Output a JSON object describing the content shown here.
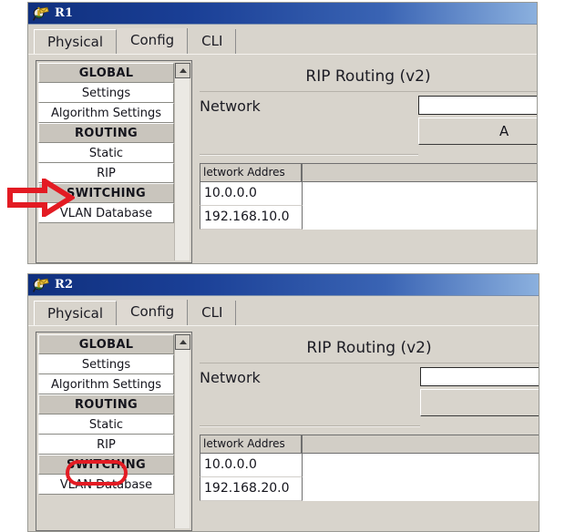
{
  "windows": [
    {
      "title": "R1",
      "icon": "packet-tracer-device-icon",
      "tabs": [
        {
          "label": "Physical",
          "selected": false
        },
        {
          "label": "Config",
          "selected": true
        },
        {
          "label": "CLI",
          "selected": false
        }
      ],
      "sidebar": {
        "items": [
          {
            "label": "GLOBAL",
            "type": "header"
          },
          {
            "label": "Settings",
            "type": "leaf"
          },
          {
            "label": "Algorithm Settings",
            "type": "leaf"
          },
          {
            "label": "ROUTING",
            "type": "header"
          },
          {
            "label": "Static",
            "type": "leaf"
          },
          {
            "label": "RIP",
            "type": "leaf"
          },
          {
            "label": "SWITCHING",
            "type": "header"
          },
          {
            "label": "VLAN Database",
            "type": "leaf"
          }
        ],
        "scroll_up_icon": "triangle-up-icon"
      },
      "panel": {
        "title": "RIP Routing (v2)",
        "network_label": "Network",
        "network_input_value": "",
        "network_input_placeholder": "",
        "add_button_label": "A",
        "table": {
          "columns": [
            "letwork Addres"
          ],
          "rows": [
            [
              "10.0.0.0"
            ],
            [
              "192.168.10.0"
            ]
          ]
        }
      },
      "annotation": {
        "kind": "red-arrow-right",
        "color": "#e31b23",
        "target": "RIP"
      }
    },
    {
      "title": "R2",
      "icon": "packet-tracer-device-icon",
      "tabs": [
        {
          "label": "Physical",
          "selected": false
        },
        {
          "label": "Config",
          "selected": true
        },
        {
          "label": "CLI",
          "selected": false
        }
      ],
      "sidebar": {
        "items": [
          {
            "label": "GLOBAL",
            "type": "header"
          },
          {
            "label": "Settings",
            "type": "leaf"
          },
          {
            "label": "Algorithm Settings",
            "type": "leaf"
          },
          {
            "label": "ROUTING",
            "type": "header"
          },
          {
            "label": "Static",
            "type": "leaf"
          },
          {
            "label": "RIP",
            "type": "leaf"
          },
          {
            "label": "SWITCHING",
            "type": "header"
          },
          {
            "label": "VLAN Database",
            "type": "leaf"
          }
        ],
        "scroll_up_icon": "triangle-up-icon"
      },
      "panel": {
        "title": "RIP Routing (v2)",
        "network_label": "Network",
        "network_input_value": "",
        "network_input_placeholder": "",
        "add_button_label": "",
        "table": {
          "columns": [
            "letwork Addres"
          ],
          "rows": [
            [
              "10.0.0.0"
            ],
            [
              "192.168.20.0"
            ]
          ]
        }
      },
      "annotation": {
        "kind": "red-rounded-rect",
        "color": "#e31b23",
        "target": "RIP"
      }
    }
  ],
  "colors": {
    "window_face": "#d8d4cc",
    "title_dark": "#10307e",
    "title_light": "#8bb0de",
    "annotation_red": "#e31b23",
    "field_white": "#ffffff"
  }
}
